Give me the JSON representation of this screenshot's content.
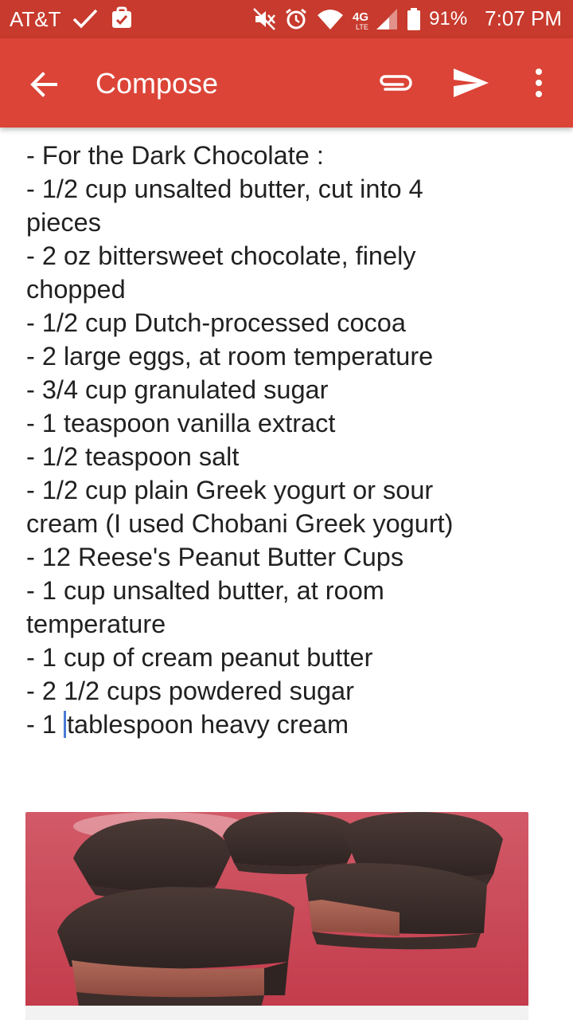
{
  "status_bar": {
    "carrier": "AT&T",
    "battery_percent": "91%",
    "time": "7:07 PM",
    "network": "4G LTE"
  },
  "app_bar": {
    "title": "Compose",
    "icons": [
      "back-arrow-icon",
      "attach-icon",
      "send-icon",
      "more-vert-icon"
    ]
  },
  "compose": {
    "lines": [
      "- For the Dark Chocolate :",
      "- 1/2 cup unsalted butter, cut into 4",
      "pieces",
      "- 2 oz bittersweet chocolate, finely",
      "chopped",
      "- 1/2 cup Dutch-processed cocoa",
      "- 2 large eggs, at room temperature",
      "- 3/4 cup granulated sugar",
      "- 1 teaspoon vanilla extract",
      "- 1/2 teaspoon salt",
      "- 1/2 cup plain Greek yogurt or sour",
      "cream (I used Chobani Greek yogurt)",
      "- 12 Reese's Peanut Butter Cups",
      "- 1 cup unsalted butter, at room",
      "temperature",
      "- 1 cup of cream peanut butter",
      "- 2 1/2 cups powdered sugar"
    ],
    "last_line_before_cursor": "- 1 ",
    "last_line_after_cursor": "tablespoon heavy cream"
  },
  "colors": {
    "status_bar": "#c73a2d",
    "app_bar": "#db4437",
    "cursor": "#4a7bd6"
  }
}
